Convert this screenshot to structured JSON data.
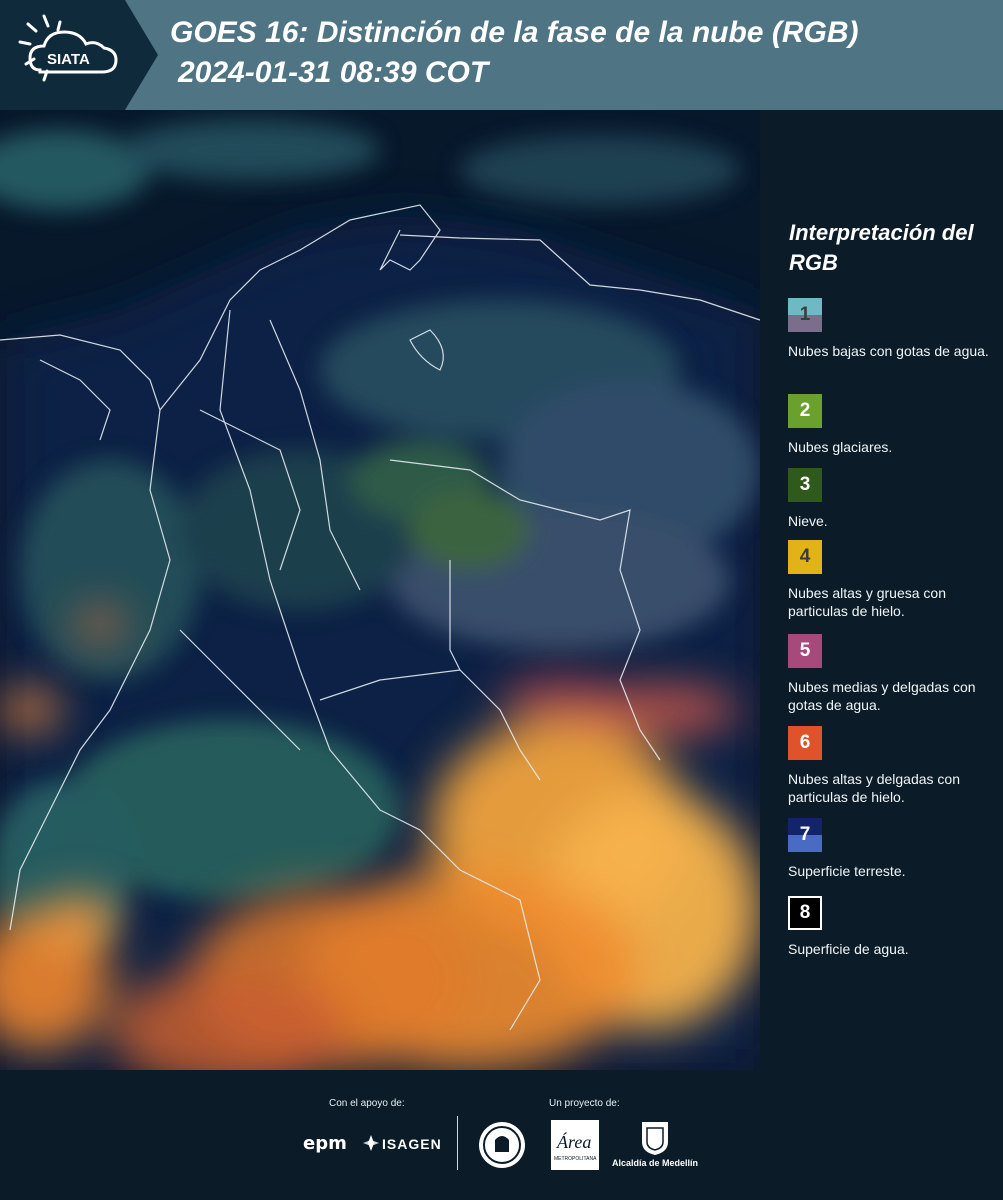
{
  "header": {
    "logo_text": "SIATA",
    "title": "GOES 16: Distinción de la fase de la nube (RGB)",
    "subtitle": "2024-01-31 08:39 COT"
  },
  "legend": {
    "title": "Interpretación del RGB",
    "items": [
      {
        "number": "1",
        "text": "Nubes bajas con gotas de agua.",
        "color_top": "#6fb9c4",
        "color_bottom": "#7a6e8c",
        "num_color": "#3b3b3b"
      },
      {
        "number": "2",
        "text": "Nubes glaciares.",
        "color_top": "#6aa12c",
        "color_bottom": "#6aa12c",
        "num_color": "#ffffff"
      },
      {
        "number": "3",
        "text": "Nieve.",
        "color_top": "#2f5a1b",
        "color_bottom": "#2f5a1b",
        "num_color": "#ffffff"
      },
      {
        "number": "4",
        "text": "Nubes altas y gruesa con particulas de hielo.",
        "color_top": "#e2b316",
        "color_bottom": "#e2b316",
        "num_color": "#3b3b3b"
      },
      {
        "number": "5",
        "text": "Nubes medias y delgadas con gotas de agua.",
        "color_top": "#a8497c",
        "color_bottom": "#a8497c",
        "num_color": "#ffffff"
      },
      {
        "number": "6",
        "text": "Nubes altas y delgadas con particulas de hielo.",
        "color_top": "#e0522a",
        "color_bottom": "#e0522a",
        "num_color": "#ffffff"
      },
      {
        "number": "7",
        "text": "Superficie terreste.",
        "color_top": "#13246b",
        "color_bottom": "#4a6bc4",
        "num_color": "#ffffff"
      },
      {
        "number": "8",
        "text": "Superficie de agua.",
        "color_top": "#000000",
        "color_bottom": "#000000",
        "num_color": "#ffffff"
      }
    ]
  },
  "footer": {
    "support_label": "Con el apoyo de:",
    "project_label": "Un proyecto de:",
    "epm": "epm",
    "isagen": "ISAGEN",
    "area_text": "Área",
    "area_sub": "METROPOLITANA",
    "alcaldia": "Alcaldía de Medellín"
  }
}
